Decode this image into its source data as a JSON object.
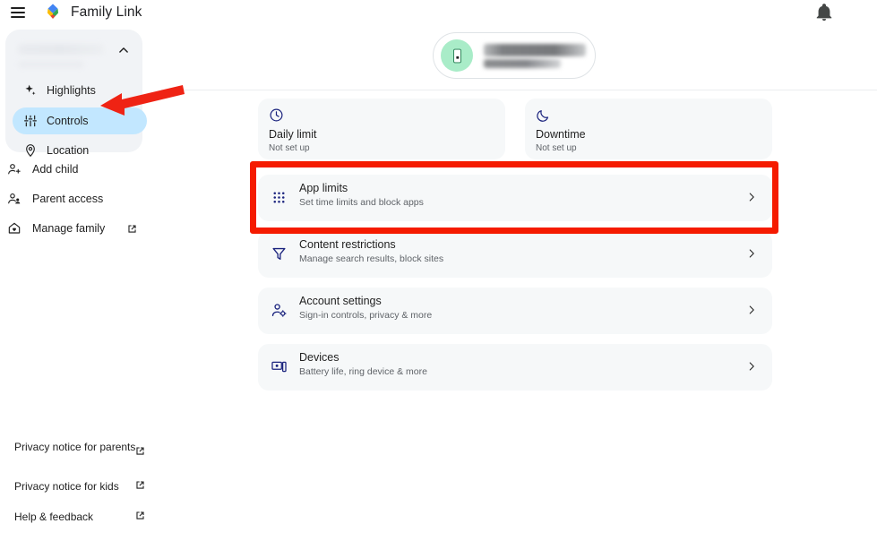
{
  "header": {
    "menu_icon": "hamburger-menu-icon",
    "logo_icon": "family-link-logo",
    "title": "Family Link",
    "bell_icon": "notification-bell-icon"
  },
  "sidebar": {
    "child_card": {
      "name_redacted": "",
      "sub_redacted": "",
      "collapse_icon": "chevron-up-icon"
    },
    "nav": [
      {
        "label": "Highlights",
        "icon": "sparkle-icon",
        "active": false
      },
      {
        "label": "Controls",
        "icon": "tune-sliders-icon",
        "active": true
      },
      {
        "label": "Location",
        "icon": "location-pin-icon",
        "active": false
      }
    ],
    "menu": [
      {
        "label": "Add child",
        "icon": "person-add-icon",
        "external": false
      },
      {
        "label": "Parent access",
        "icon": "supervisor-account-icon",
        "external": false
      },
      {
        "label": "Manage family",
        "icon": "home-heart-icon",
        "external": true
      }
    ],
    "footer": [
      {
        "label": "Privacy notice for parents",
        "external_icon": "open-in-new-icon"
      },
      {
        "label": "Privacy notice for kids",
        "external_icon": "open-in-new-icon"
      },
      {
        "label": "Help & feedback",
        "external_icon": "open-in-new-icon"
      }
    ]
  },
  "main": {
    "child_chip": {
      "avatar_icon": "phone-device-icon",
      "avatar_color": "#a9ecc8",
      "name_redacted": "",
      "sub_redacted": ""
    },
    "tiles": [
      {
        "title": "Daily limit",
        "subtitle": "Not set up",
        "icon": "clock-icon"
      },
      {
        "title": "Downtime",
        "subtitle": "Not set up",
        "icon": "moon-icon"
      }
    ],
    "rows": [
      {
        "title": "App limits",
        "subtitle": "Set time limits and block apps",
        "icon": "apps-grid-icon",
        "chevron": "chevron-right-icon",
        "highlighted": true
      },
      {
        "title": "Content restrictions",
        "subtitle": "Manage search results, block sites",
        "icon": "filter-funnel-icon",
        "chevron": "chevron-right-icon",
        "highlighted": false
      },
      {
        "title": "Account settings",
        "subtitle": "Sign-in controls, privacy & more",
        "icon": "person-gear-icon",
        "chevron": "chevron-right-icon",
        "highlighted": false
      },
      {
        "title": "Devices",
        "subtitle": "Battery life, ring device & more",
        "icon": "devices-icon",
        "chevron": "chevron-right-icon",
        "highlighted": false
      }
    ]
  },
  "annotations": {
    "highlight_color": "#f51b00",
    "arrow_color": "#ef2314",
    "arrow_target": "Controls",
    "box_target": "App limits"
  }
}
